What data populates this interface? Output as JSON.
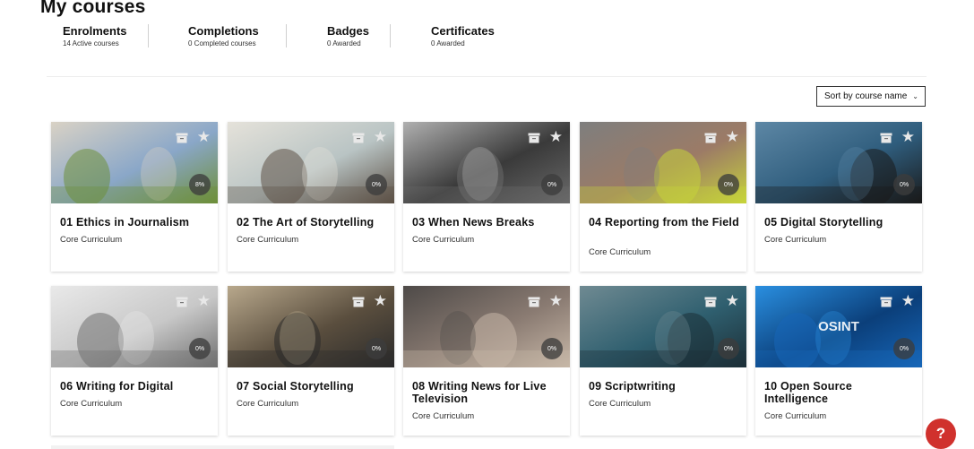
{
  "page_title": "My courses",
  "stats": [
    {
      "label": "Enrolments",
      "sub": "14 Active courses"
    },
    {
      "label": "Completions",
      "sub": "0 Completed courses"
    },
    {
      "label": "Badges",
      "sub": "0 Awarded"
    },
    {
      "label": "Certificates",
      "sub": "0 Awarded"
    }
  ],
  "sort": {
    "label": "Sort by course name"
  },
  "courses": [
    {
      "title": "01 Ethics in Journalism",
      "subtitle": "Core Curriculum",
      "progress": "8%",
      "image_colors": [
        "#8aa7c8",
        "#6e8f3a",
        "#d9d2c5"
      ]
    },
    {
      "title": "02 The Art of Storytelling",
      "subtitle": "Core Curriculum",
      "progress": "0%",
      "image_colors": [
        "#b9c4c4",
        "#5c5045",
        "#e5e2da"
      ]
    },
    {
      "title": "03 When News Breaks",
      "subtitle": "Core Curriculum",
      "progress": "0%",
      "image_colors": [
        "#3a3a3a",
        "#6a6a6a",
        "#b0b0b0"
      ]
    },
    {
      "title": "04 Reporting from the Field",
      "subtitle": "Core Curriculum",
      "progress": "0%",
      "image_colors": [
        "#9c7b66",
        "#c7d43a",
        "#7e7e7e"
      ]
    },
    {
      "title": "05 Digital Storytelling",
      "subtitle": "Core Curriculum",
      "progress": "0%",
      "image_colors": [
        "#2f5d7d",
        "#1a1a1a",
        "#5d87a5"
      ]
    },
    {
      "title": "06 Writing for Digital",
      "subtitle": "Core Curriculum",
      "progress": "0%",
      "image_colors": [
        "#c8c8c8",
        "#707070",
        "#e9e9e9"
      ]
    },
    {
      "title": "07 Social Storytelling",
      "subtitle": "Core Curriculum",
      "progress": "0%",
      "image_colors": [
        "#5a4e3e",
        "#2a2a2a",
        "#b8a88c"
      ]
    },
    {
      "title": "08 Writing News for Live Television",
      "subtitle": "Core Curriculum",
      "progress": "0%",
      "image_colors": [
        "#8a7b72",
        "#c7b7a7",
        "#4e4a48"
      ]
    },
    {
      "title": "09 Scriptwriting",
      "subtitle": "Core Curriculum",
      "progress": "0%",
      "image_colors": [
        "#2f5f6f",
        "#1c2f37",
        "#6f8a92"
      ]
    },
    {
      "title": "10 Open Source Intelligence",
      "subtitle": "Core Curriculum",
      "progress": "0%",
      "image_colors": [
        "#0b3f7a",
        "#1766b8",
        "#2a8fe0"
      ],
      "image_text": "OSINT"
    }
  ],
  "help": {
    "label": "?"
  }
}
